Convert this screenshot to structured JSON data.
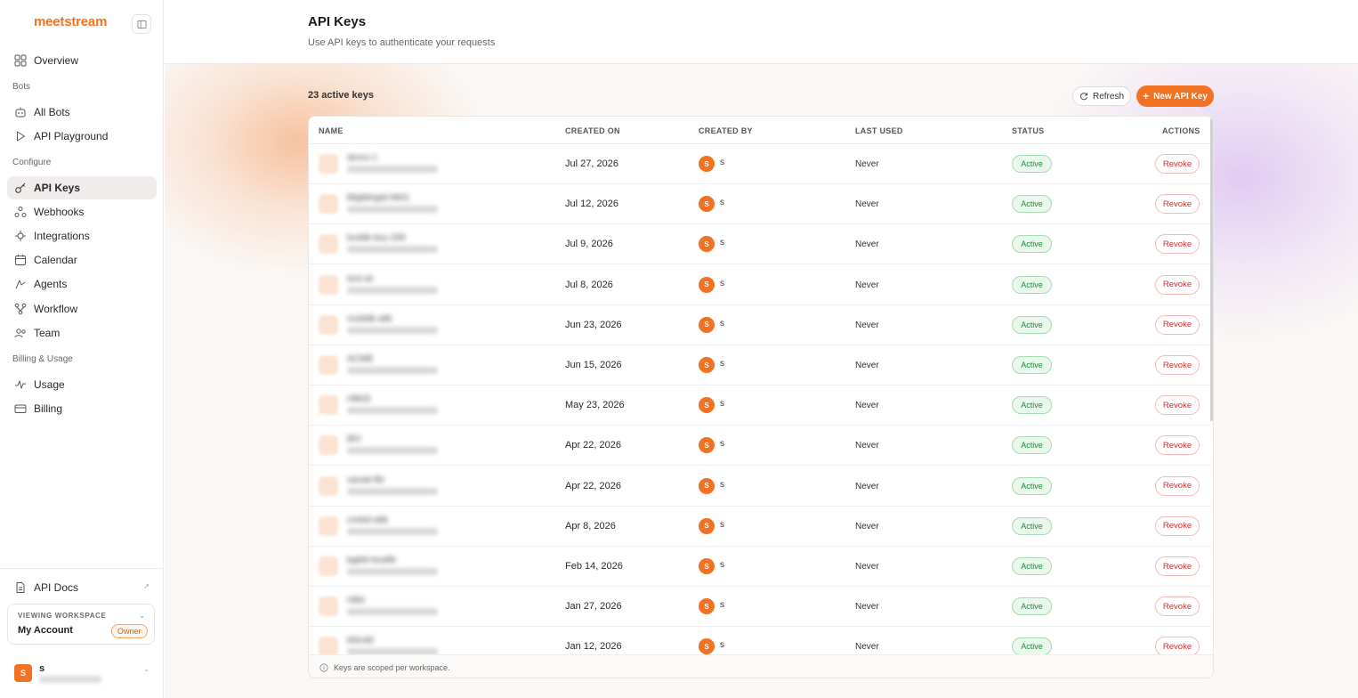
{
  "app": {
    "logo": "meetstream"
  },
  "sidebar": {
    "overview": "Overview",
    "section_bots": "Bots",
    "all_bots": "All Bots",
    "api_playground": "API Playground",
    "section_configure": "Configure",
    "api_keys": "API Keys",
    "webhooks": "Webhooks",
    "integrations": "Integrations",
    "calendar": "Calendar",
    "agents": "Agents",
    "workflow": "Workflow",
    "team": "Team",
    "section_billing": "Billing & Usage",
    "usage": "Usage",
    "billing": "Billing",
    "api_docs": "API Docs",
    "workspace_label": "VIEWING WORKSPACE",
    "workspace_name": "My Account",
    "workspace_role": "Owner",
    "user_initial": "S",
    "user_name": "s"
  },
  "page": {
    "title": "API Keys",
    "subtitle": "Use API keys to authenticate your requests",
    "count": "23 active keys",
    "refresh_label": "Refresh",
    "new_key_label": "New API Key"
  },
  "table": {
    "columns": {
      "name": "NAME",
      "created_on": "CREATED ON",
      "created_by": "CREATED BY",
      "last_used": "LAST USED",
      "status": "STATUS",
      "actions": "ACTIONS"
    },
    "footer": "Keys are scoped per workspace.",
    "rows": [
      {
        "name": "demo-1",
        "created_on": "Jul 27, 2026",
        "creator_initial": "S",
        "creator": "s",
        "last_used": "Never",
        "status": "Active",
        "action": "Revoke"
      },
      {
        "name": "Bfgttkhgtd-9901",
        "created_on": "Jul 12, 2026",
        "creator_initial": "S",
        "creator": "s",
        "last_used": "Never",
        "status": "Active",
        "action": "Revoke"
      },
      {
        "name": "bcddk-key-299",
        "created_on": "Jul 9, 2026",
        "creator_initial": "S",
        "creator": "s",
        "last_used": "Never",
        "status": "Active",
        "action": "Revoke"
      },
      {
        "name": "test-sk",
        "created_on": "Jul 8, 2026",
        "creator_initial": "S",
        "creator": "s",
        "last_used": "Never",
        "status": "Active",
        "action": "Revoke"
      },
      {
        "name": "mcbldk-atlk",
        "created_on": "Jun 23, 2026",
        "creator_initial": "S",
        "creator": "s",
        "last_used": "Never",
        "status": "Active",
        "action": "Revoke"
      },
      {
        "name": "ACMB",
        "created_on": "Jun 15, 2026",
        "creator_initial": "S",
        "creator": "s",
        "last_used": "Never",
        "status": "Active",
        "action": "Revoke"
      },
      {
        "name": "HBKE",
        "created_on": "May 23, 2026",
        "creator_initial": "S",
        "creator": "s",
        "last_used": "Never",
        "status": "Active",
        "action": "Revoke"
      },
      {
        "name": "BtV",
        "created_on": "Apr 22, 2026",
        "creator_initial": "S",
        "creator": "s",
        "last_used": "Never",
        "status": "Active",
        "action": "Revoke"
      },
      {
        "name": "xanatt-fbt",
        "created_on": "Apr 22, 2026",
        "creator_initial": "S",
        "creator": "s",
        "last_used": "Never",
        "status": "Active",
        "action": "Revoke"
      },
      {
        "name": "cmktd-ddk",
        "created_on": "Apr 8, 2026",
        "creator_initial": "S",
        "creator": "s",
        "last_used": "Never",
        "status": "Active",
        "action": "Revoke"
      },
      {
        "name": "bgkbt-bnaftk",
        "created_on": "Feb 14, 2026",
        "creator_initial": "S",
        "creator": "s",
        "last_used": "Never",
        "status": "Active",
        "action": "Revoke"
      },
      {
        "name": "HBd",
        "created_on": "Jan 27, 2026",
        "creator_initial": "S",
        "creator": "s",
        "last_used": "Never",
        "status": "Active",
        "action": "Revoke"
      },
      {
        "name": "kbtcdd",
        "created_on": "Jan 12, 2026",
        "creator_initial": "S",
        "creator": "s",
        "last_used": "Never",
        "status": "Active",
        "action": "Revoke"
      }
    ]
  },
  "colors": {
    "accent": "#f07222",
    "active": "#1e8a3b",
    "revoke": "#d23030"
  }
}
